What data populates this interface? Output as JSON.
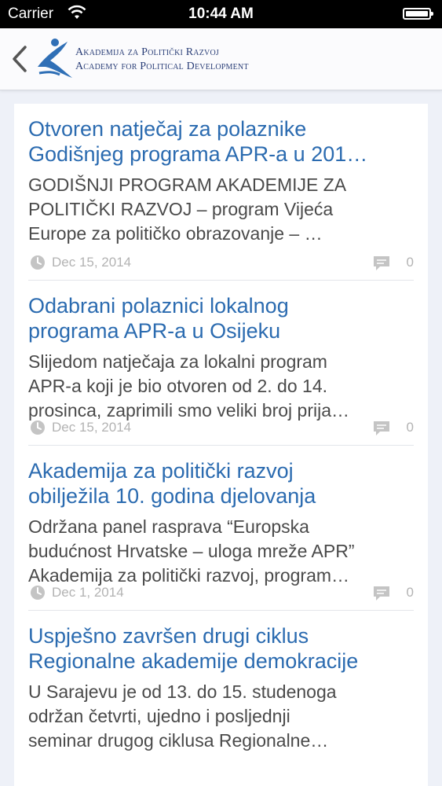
{
  "status_bar": {
    "carrier": "Carrier",
    "time": "10:44 AM"
  },
  "nav": {
    "logo_line1": "Akademija za Politički Razvoj",
    "logo_line2": "Academy for Political Development"
  },
  "colors": {
    "accent": "#2b6bb0",
    "logo": "#2b3f78"
  },
  "articles": [
    {
      "title_line1": "Otvoren natječaj za polaznike",
      "title_line2": "Godišnjeg programa APR-a u 201…",
      "excerpt_line1": "GODIŠNJI PROGRAM AKADEMIJE ZA",
      "excerpt_line2": "POLITIČKI RAZVOJ – program Vijeća",
      "excerpt_line3": "Europe za političko obrazovanje –  …",
      "date": "Dec 15, 2014",
      "comments": "0"
    },
    {
      "title_line1": "Odabrani polaznici lokalnog",
      "title_line2": "programa APR-a u Osijeku",
      "excerpt_line1": "Slijedom natječaja za lokalni program",
      "excerpt_line2": "APR-a koji je bio otvoren od 2. do 14.",
      "excerpt_line3": "prosinca, zaprimili smo veliki broj prija…",
      "date": "Dec 15, 2014",
      "comments": "0"
    },
    {
      "title_line1": "Akademija za politički razvoj",
      "title_line2": "obilježila 10. godina djelovanja",
      "excerpt_line1": "Održana panel rasprava “Europska",
      "excerpt_line2": "budućnost Hrvatske – uloga mreže APR”",
      "excerpt_line3": " Akademija za politički razvoj, program…",
      "date": "Dec 1, 2014",
      "comments": "0"
    },
    {
      "title_line1": "Uspješno završen drugi ciklus",
      "title_line2": "Regionalne akademije demokracije",
      "excerpt_line1": "U Sarajevu je od 13. do 15. studenoga",
      "excerpt_line2": "održan četvrti, ujedno i posljednji",
      "excerpt_line3": "seminar drugog ciklusa Regionalne…"
    }
  ]
}
